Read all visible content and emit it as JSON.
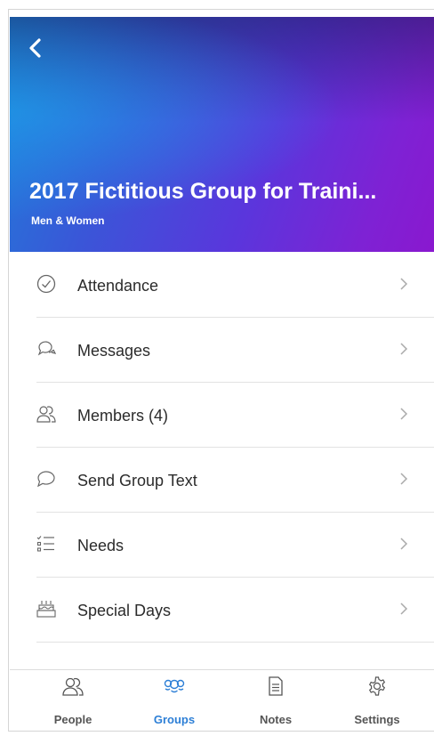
{
  "header": {
    "title": "2017 Fictitious Group for Traini...",
    "subtitle": "Men & Women",
    "back_icon": "chevron-left-icon"
  },
  "menu": {
    "items": [
      {
        "label": "Attendance",
        "icon": "check-circle-icon"
      },
      {
        "label": "Messages",
        "icon": "chat-bubbles-icon"
      },
      {
        "label": "Members (4)",
        "icon": "people-icon"
      },
      {
        "label": "Send Group Text",
        "icon": "speech-bubble-icon"
      },
      {
        "label": "Needs",
        "icon": "checklist-icon"
      },
      {
        "label": "Special Days",
        "icon": "cake-icon"
      }
    ]
  },
  "tabbar": {
    "tabs": [
      {
        "label": "People",
        "icon": "people-icon",
        "active": false
      },
      {
        "label": "Groups",
        "icon": "groups-icon",
        "active": true
      },
      {
        "label": "Notes",
        "icon": "note-icon",
        "active": false
      },
      {
        "label": "Settings",
        "icon": "gear-icon",
        "active": false
      }
    ],
    "active_color": "#2d7fd6",
    "inactive_color": "#555555"
  },
  "colors": {
    "hero_gradient_start": "#1f7fd9",
    "hero_gradient_end": "#8a18cf"
  }
}
